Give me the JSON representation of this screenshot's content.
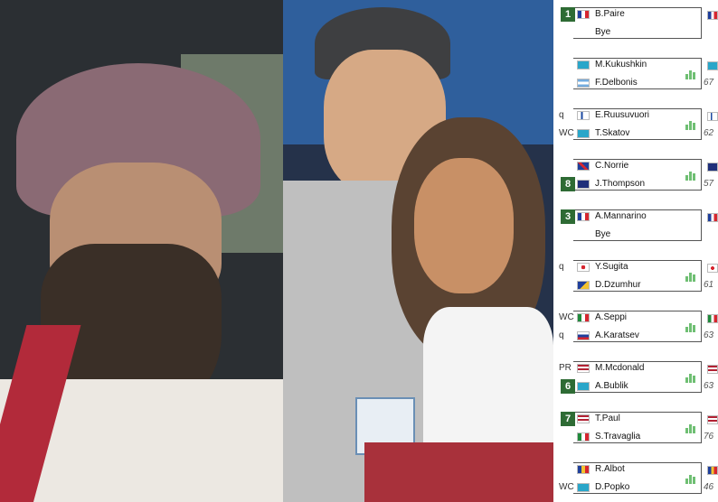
{
  "bracket": {
    "matches": [
      {
        "players": [
          {
            "seed": "1",
            "tag": "",
            "flag": "france",
            "name": "B.Paire"
          },
          {
            "seed": "",
            "tag": "",
            "flag": "",
            "name": "Bye"
          }
        ],
        "score": "",
        "next_flag": "france"
      },
      {
        "players": [
          {
            "seed": "",
            "tag": "",
            "flag": "kazakhstan",
            "name": "M.Kukushkin"
          },
          {
            "seed": "",
            "tag": "",
            "flag": "argentina",
            "name": "F.Delbonis"
          }
        ],
        "score": "67",
        "next_flag": "kazakhstan"
      },
      {
        "players": [
          {
            "seed": "",
            "tag": "q",
            "flag": "finland",
            "name": "E.Ruusuvuori"
          },
          {
            "seed": "",
            "tag": "WC",
            "flag": "kazakhstan",
            "name": "T.Skatov"
          }
        ],
        "score": "62",
        "next_flag": "finland"
      },
      {
        "players": [
          {
            "seed": "",
            "tag": "",
            "flag": "uk",
            "name": "C.Norrie"
          },
          {
            "seed": "8",
            "tag": "",
            "flag": "australia",
            "name": "J.Thompson"
          }
        ],
        "score": "57",
        "next_flag": "australia"
      },
      {
        "players": [
          {
            "seed": "3",
            "tag": "",
            "flag": "france",
            "name": "A.Mannarino"
          },
          {
            "seed": "",
            "tag": "",
            "flag": "",
            "name": "Bye"
          }
        ],
        "score": "",
        "next_flag": "france"
      },
      {
        "players": [
          {
            "seed": "",
            "tag": "q",
            "flag": "japan",
            "name": "Y.Sugita"
          },
          {
            "seed": "",
            "tag": "",
            "flag": "bosnia",
            "name": "D.Dzumhur"
          }
        ],
        "score": "61",
        "next_flag": "japan"
      },
      {
        "players": [
          {
            "seed": "",
            "tag": "WC",
            "flag": "italy",
            "name": "A.Seppi"
          },
          {
            "seed": "",
            "tag": "q",
            "flag": "russia",
            "name": "A.Karatsev"
          }
        ],
        "score": "63",
        "next_flag": "italy"
      },
      {
        "players": [
          {
            "seed": "",
            "tag": "PR",
            "flag": "usa",
            "name": "M.Mcdonald"
          },
          {
            "seed": "6",
            "tag": "",
            "flag": "kazakhstan",
            "name": "A.Bublik"
          }
        ],
        "score": "63",
        "next_flag": "usa"
      },
      {
        "players": [
          {
            "seed": "7",
            "tag": "",
            "flag": "usa",
            "name": "T.Paul"
          },
          {
            "seed": "",
            "tag": "",
            "flag": "italy",
            "name": "S.Travaglia"
          }
        ],
        "score": "76",
        "next_flag": "usa"
      },
      {
        "players": [
          {
            "seed": "",
            "tag": "",
            "flag": "moldova",
            "name": "R.Albot"
          },
          {
            "seed": "",
            "tag": "WC",
            "flag": "kazakhstan",
            "name": "D.Popko"
          }
        ],
        "score": "46",
        "next_flag": "moldova"
      }
    ]
  },
  "colors": {
    "seed_green": "#2e6b34",
    "stats_green": "#6fbf73",
    "france": [
      "#1f3f9c",
      "#ffffff",
      "#d6262f"
    ],
    "italy": [
      "#1f8a3b",
      "#ffffff",
      "#d6262f"
    ],
    "kazakhstan": "#2aa6c9",
    "usa": "#b22234",
    "japan": "#ffffff",
    "finland": "#ffffff"
  }
}
